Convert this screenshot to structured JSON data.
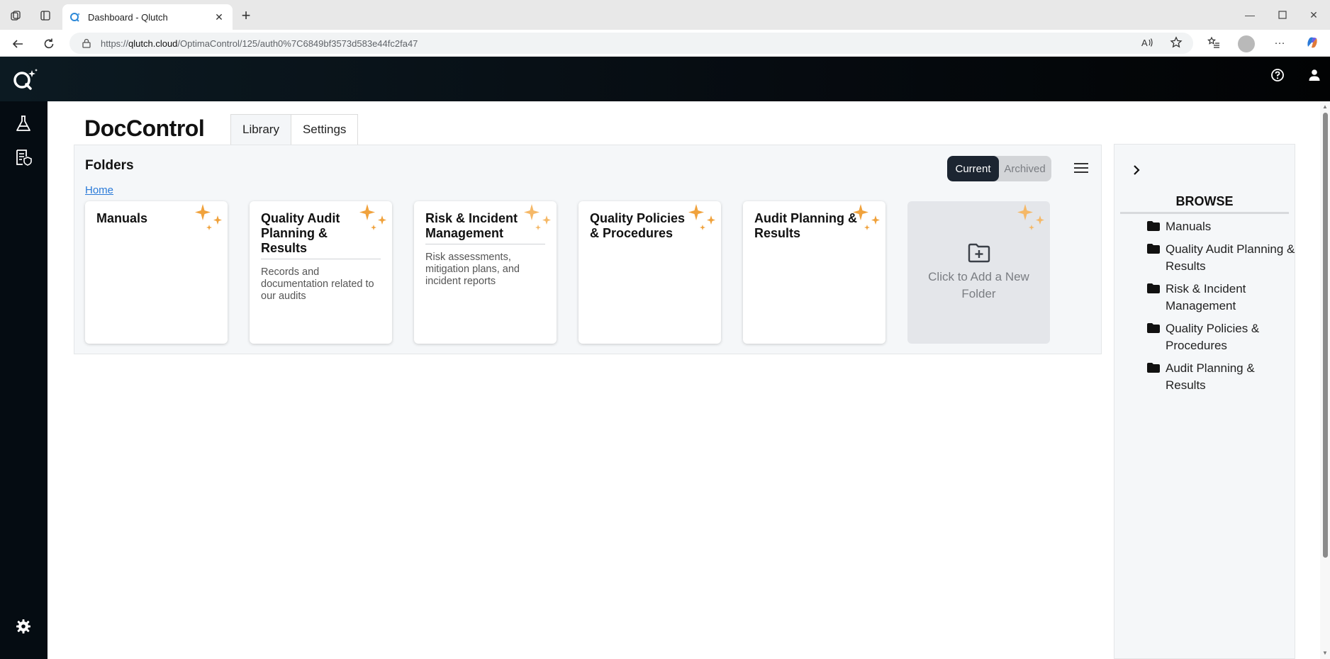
{
  "browser": {
    "tab_title": "Dashboard - Qlutch",
    "url_domain": "qlutch.cloud",
    "url_prefix": "https://",
    "url_path": "/OptimaControl/125/auth0%7C6849bf3573d583e44fc2fa47"
  },
  "app": {
    "title": "DocControl",
    "tabs": [
      {
        "label": "Library"
      },
      {
        "label": "Settings"
      }
    ]
  },
  "folders": {
    "title": "Folders",
    "breadcrumb": "Home",
    "toggle": {
      "current": "Current",
      "archived": "Archived",
      "selected": "Current"
    },
    "cards": [
      {
        "title": "Manuals",
        "description": ""
      },
      {
        "title": "Quality Audit Planning & Results",
        "description": "Records and documentation related to our audits"
      },
      {
        "title": "Risk & Incident Management",
        "description": "Risk assessments, mitigation plans, and incident reports"
      },
      {
        "title": "Quality Policies & Procedures",
        "description": ""
      },
      {
        "title": "Audit Planning & Results",
        "description": ""
      }
    ],
    "add_card": "Click to Add a New Folder"
  },
  "browse": {
    "title": "BROWSE",
    "items": [
      {
        "label": "Manuals"
      },
      {
        "label": "Quality Audit Planning & Results"
      },
      {
        "label": "Risk & Incident Management"
      },
      {
        "label": "Quality Policies & Procedures"
      },
      {
        "label": "Audit Planning & Results"
      }
    ]
  },
  "colors": {
    "accent_orange": "#f0a23c",
    "toggle_active": "#1c2531",
    "link": "#2a7ad8"
  },
  "icons": {
    "rail": [
      "flask-icon",
      "document-shield-icon",
      "settings-gear-icon"
    ],
    "header": [
      "help-icon",
      "user-icon"
    ]
  }
}
